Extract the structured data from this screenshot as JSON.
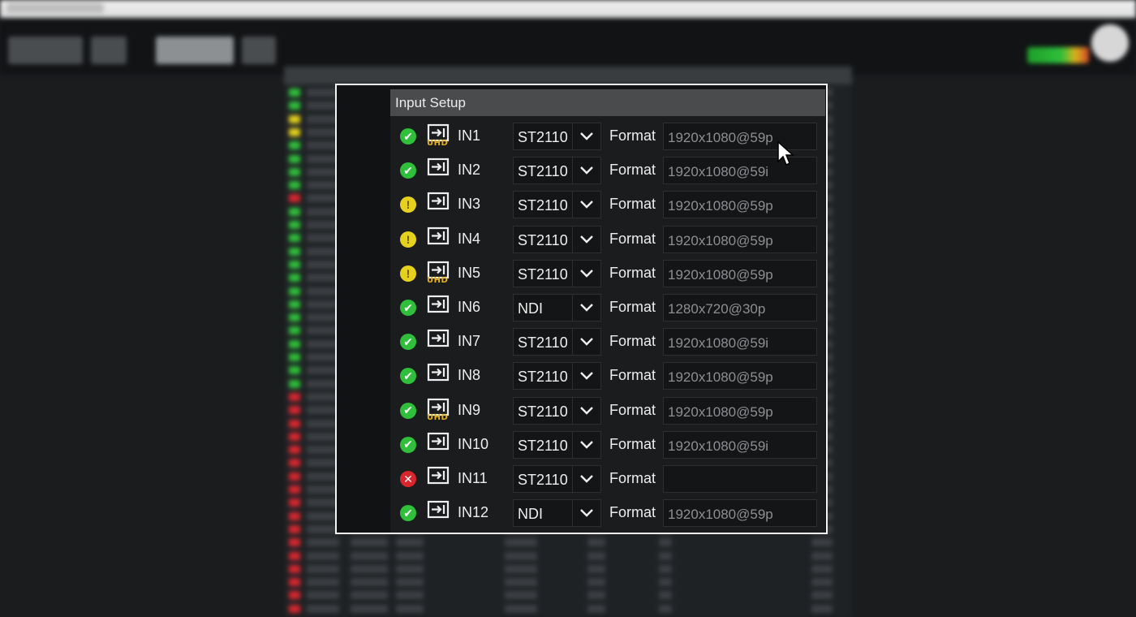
{
  "dialog": {
    "title": "Input Setup",
    "format_label": "Format",
    "colors": {
      "ok": "#2fbf3a",
      "warn": "#e6d21d",
      "error": "#d8262e",
      "uhd": "#e8b118"
    },
    "inputs": [
      {
        "status": "ok",
        "status_icon": "check-circle-icon",
        "uhd": true,
        "uhd_text": "UHD",
        "name": "IN1",
        "protocol": "ST2110",
        "format": "1920x1080@59p"
      },
      {
        "status": "ok",
        "status_icon": "check-circle-icon",
        "uhd": false,
        "uhd_text": "",
        "name": "IN2",
        "protocol": "ST2110",
        "format": "1920x1080@59i"
      },
      {
        "status": "warn",
        "status_icon": "exclamation-circle-icon",
        "uhd": false,
        "uhd_text": "",
        "name": "IN3",
        "protocol": "ST2110",
        "format": "1920x1080@59p"
      },
      {
        "status": "warn",
        "status_icon": "exclamation-circle-icon",
        "uhd": false,
        "uhd_text": "",
        "name": "IN4",
        "protocol": "ST2110",
        "format": "1920x1080@59p"
      },
      {
        "status": "warn",
        "status_icon": "exclamation-circle-icon",
        "uhd": true,
        "uhd_text": "UHD",
        "name": "IN5",
        "protocol": "ST2110",
        "format": "1920x1080@59p"
      },
      {
        "status": "ok",
        "status_icon": "check-circle-icon",
        "uhd": false,
        "uhd_text": "",
        "name": "IN6",
        "protocol": "NDI",
        "format": "1280x720@30p"
      },
      {
        "status": "ok",
        "status_icon": "check-circle-icon",
        "uhd": false,
        "uhd_text": "",
        "name": "IN7",
        "protocol": "ST2110",
        "format": "1920x1080@59i"
      },
      {
        "status": "ok",
        "status_icon": "check-circle-icon",
        "uhd": false,
        "uhd_text": "",
        "name": "IN8",
        "protocol": "ST2110",
        "format": "1920x1080@59p"
      },
      {
        "status": "ok",
        "status_icon": "check-circle-icon",
        "uhd": true,
        "uhd_text": "UHD",
        "name": "IN9",
        "protocol": "ST2110",
        "format": "1920x1080@59p"
      },
      {
        "status": "ok",
        "status_icon": "check-circle-icon",
        "uhd": false,
        "uhd_text": "",
        "name": "IN10",
        "protocol": "ST2110",
        "format": "1920x1080@59i"
      },
      {
        "status": "err",
        "status_icon": "x-circle-icon",
        "uhd": false,
        "uhd_text": "",
        "name": "IN11",
        "protocol": "ST2110",
        "format": ""
      },
      {
        "status": "ok",
        "status_icon": "check-circle-icon",
        "uhd": false,
        "uhd_text": "",
        "name": "IN12",
        "protocol": "NDI",
        "format": "1920x1080@59p"
      }
    ]
  },
  "cursor": {
    "icon": "mouse-pointer-icon"
  }
}
